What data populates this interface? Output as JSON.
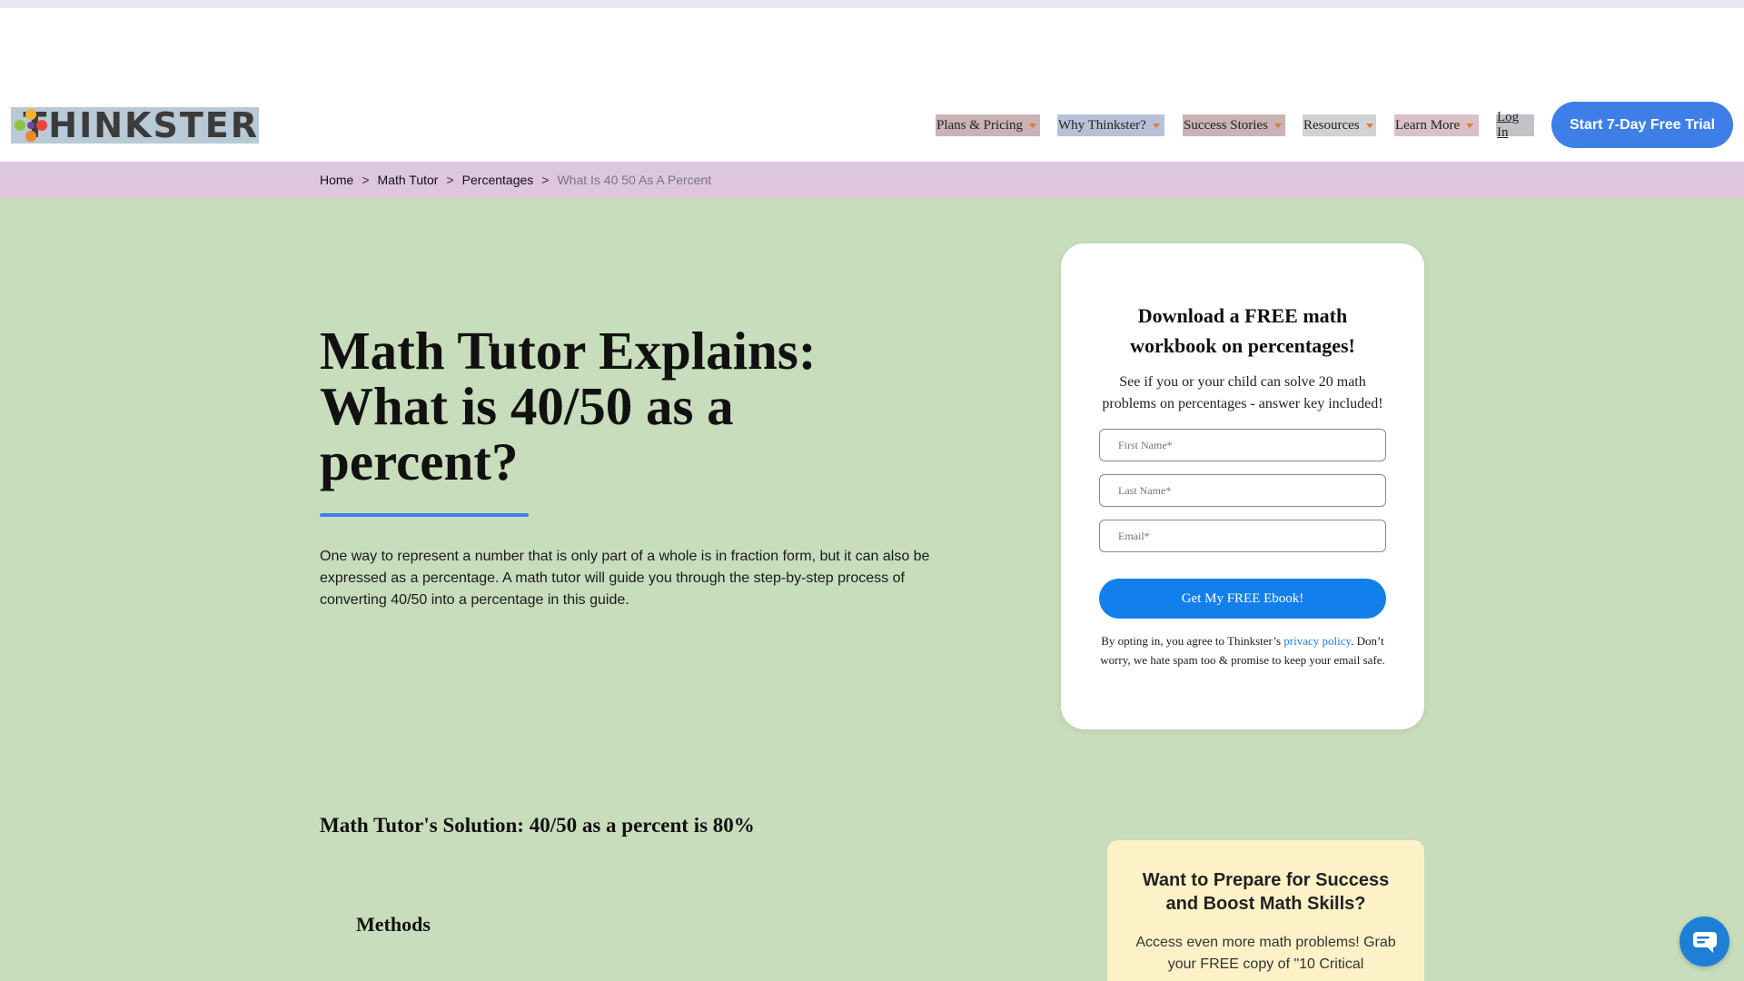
{
  "header": {
    "logo_text": "THINKSTER",
    "nav": [
      {
        "label": "Plans & Pricing"
      },
      {
        "label": "Why Thinkster?"
      },
      {
        "label": "Success Stories"
      },
      {
        "label": "Resources"
      },
      {
        "label": "Learn More"
      }
    ],
    "login_label": "Log In",
    "cta_label": "Start 7-Day Free Trial"
  },
  "breadcrumb": {
    "items": [
      "Home",
      "Math Tutor",
      "Percentages"
    ],
    "current": "What Is 40 50 As A Percent",
    "separator": ">"
  },
  "main": {
    "title": "Math Tutor Explains: What is 40/50 as a percent?",
    "intro": "One way to represent a number that is only part of a whole is in fraction form, but it can also be expressed as a percentage. A math tutor will guide you through the step-by-step process of converting 40/50 into a percentage in this guide.",
    "solution": "Math Tutor's Solution: 40/50 as a percent is 80%",
    "methods_heading": "Methods"
  },
  "download_card": {
    "title": "Download a FREE math workbook on percentages!",
    "subtitle": "See if you or your child can solve 20 math problems on percentages - answer key included!",
    "first_name_placeholder": "First Name*",
    "last_name_placeholder": "Last Name*",
    "email_placeholder": "Email*",
    "submit_label": "Get My FREE Ebook!",
    "note_prefix": "By opting in, you agree to Thinkster’s ",
    "privacy_link": "privacy policy",
    "note_suffix": ". Don’t worry, we hate spam too & promise to keep your email safe."
  },
  "promo": {
    "title": "Want to Prepare for Success and Boost Math Skills?",
    "text": "Access even more math problems! Grab your FREE copy of \"10 Critical"
  },
  "colors": {
    "accent_blue": "#3d7fe6",
    "button_blue": "#1180ec",
    "page_bg": "#c8ddbc",
    "breadcrumb_bg": "#dec6df",
    "promo_bg": "#fdf2c7"
  },
  "icons": {
    "logo": "thinkster-flower-icon",
    "nav_caret": "caret-down-icon",
    "chat": "chat-icon"
  }
}
